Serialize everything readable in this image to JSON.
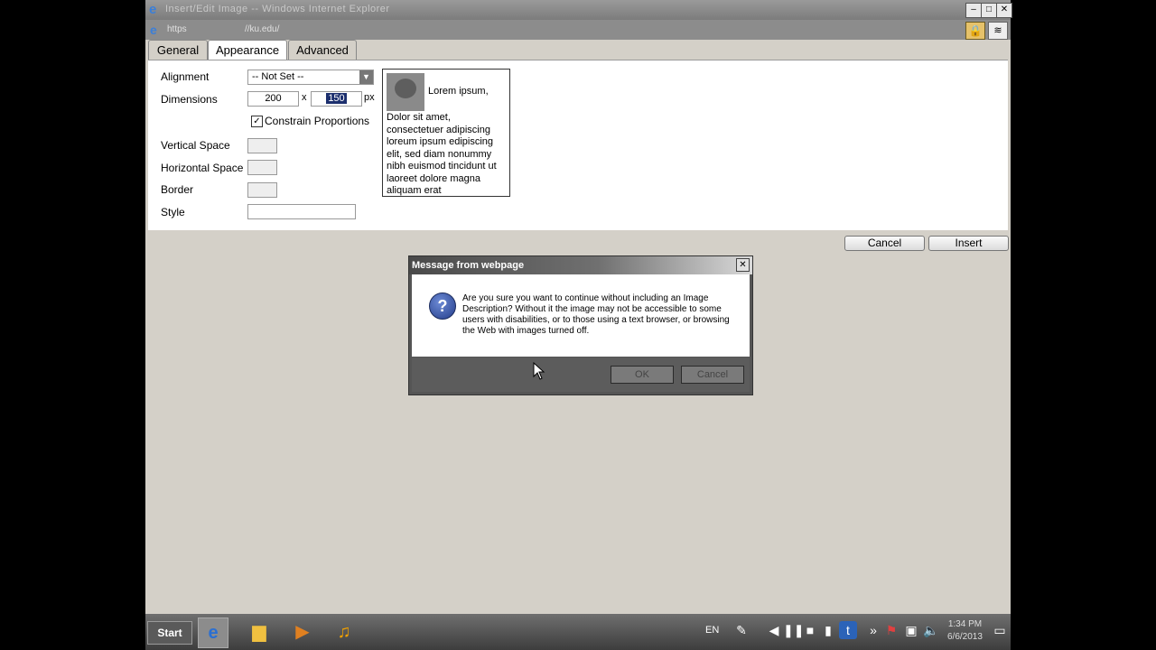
{
  "window": {
    "title": "Insert/Edit Image -- Windows Internet Explorer",
    "address_scheme": "https",
    "address_rest": "//ku.edu/"
  },
  "tabs": [
    {
      "label": "General"
    },
    {
      "label": "Appearance"
    },
    {
      "label": "Advanced"
    }
  ],
  "form": {
    "alignment_label": "Alignment",
    "alignment_value": "-- Not Set --",
    "dimensions_label": "Dimensions",
    "width_value": "200",
    "height_value": "150",
    "x_sep": "x",
    "px_unit": "px",
    "constrain_label": "Constrain Proportions",
    "constrain_check": "✓",
    "vspace_label": "Vertical Space",
    "hspace_label": "Horizontal Space",
    "border_label": "Border",
    "style_label": "Style"
  },
  "preview": {
    "first_line": "Lorem ipsum,",
    "body": "Dolor sit amet, consectetuer adipiscing loreum ipsum edipiscing elit, sed diam nonummy nibh euismod tincidunt ut laoreet dolore magna aliquam erat"
  },
  "buttons": {
    "cancel": "Cancel",
    "insert": "Insert"
  },
  "dialog": {
    "title": "Message from webpage",
    "message": "Are you sure you want to continue without including an Image Description? Without it the image may not be accessible to some users with disabilities, or to those using a text browser, or browsing the Web with images turned off.",
    "ok": "OK",
    "cancel": "Cancel",
    "close": "✕"
  },
  "taskbar": {
    "start": "Start",
    "lang": "EN",
    "time": "1:34 PM",
    "date": "6/6/2013"
  }
}
